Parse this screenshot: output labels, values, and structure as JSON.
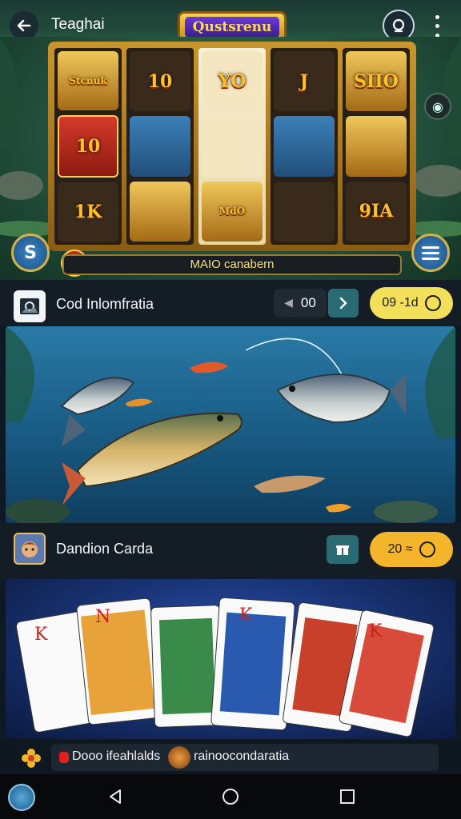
{
  "header": {
    "title": "Teaghai",
    "logo_text": "Qustsrenu"
  },
  "slot": {
    "reels": [
      [
        {
          "text": "Stcnuk",
          "style": "gold",
          "small": true
        },
        {
          "text": "10",
          "style": "red"
        },
        {
          "text": "1K",
          "style": "dark"
        }
      ],
      [
        {
          "text": "10",
          "style": "dark"
        },
        {
          "text": "",
          "style": "blue"
        },
        {
          "text": "",
          "style": "gold"
        }
      ],
      [
        {
          "text": "YO",
          "style": "cream"
        },
        {
          "text": "",
          "style": "cream"
        },
        {
          "text": "MdO",
          "style": "gold",
          "small": true
        }
      ],
      [
        {
          "text": "J",
          "style": "dark"
        },
        {
          "text": "",
          "style": "blue"
        },
        {
          "text": "",
          "style": "dark"
        }
      ],
      [
        {
          "text": "SIIO",
          "style": "gold"
        },
        {
          "text": "",
          "style": "gold"
        },
        {
          "text": "9IA",
          "style": "dark"
        }
      ]
    ],
    "status_text": "MAIO canabern",
    "left_button": "S"
  },
  "game1": {
    "label": "Cod Inlomfratia",
    "count": "00",
    "price": "09 -1d"
  },
  "game2": {
    "label": "Dandion Carda",
    "price": "20 ≈"
  },
  "footer": {
    "text1": "Dooo ifeahlalds",
    "text2": "rainoocondaratia"
  },
  "colors": {
    "gold_pill": "#f2df5a",
    "orange_pill": "#f5b52a",
    "teal_button": "#2a6b73"
  }
}
